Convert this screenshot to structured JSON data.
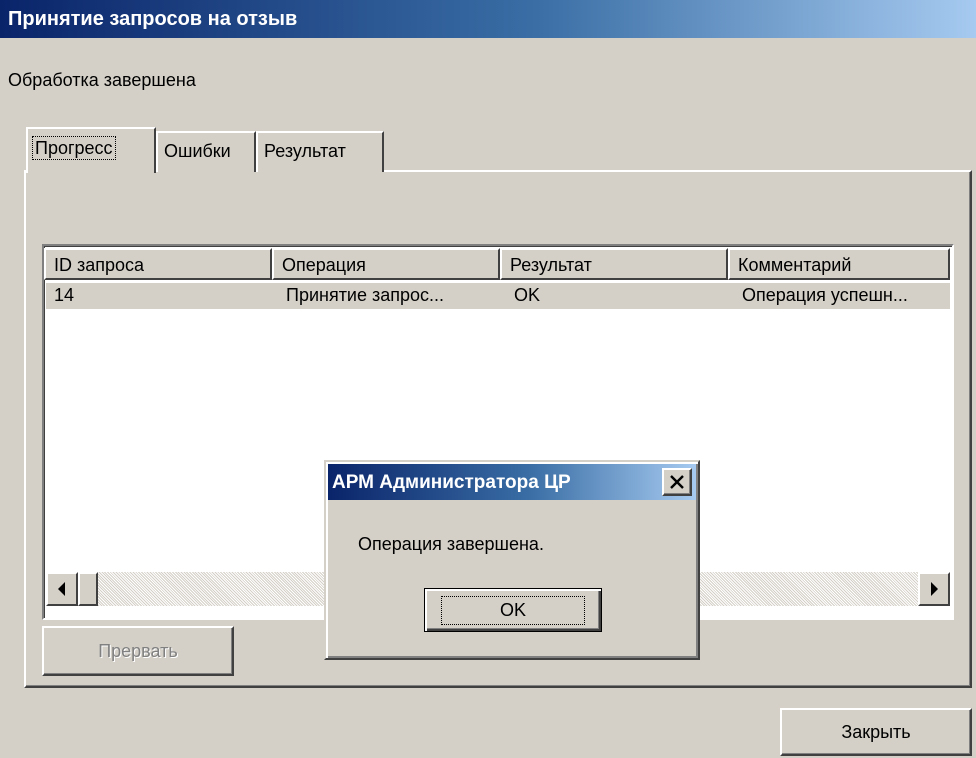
{
  "window": {
    "title": "Принятие запросов на отзыв"
  },
  "status": {
    "text": "Обработка завершена"
  },
  "tabs": [
    {
      "label": "Прогресс",
      "active": true
    },
    {
      "label": "Ошибки",
      "active": false
    },
    {
      "label": "Результат",
      "active": false
    }
  ],
  "table": {
    "columns": [
      "ID запроса",
      "Операция",
      "Результат",
      "Комментарий"
    ],
    "rows": [
      [
        "14",
        "Принятие запрос...",
        "OK",
        "Операция успешн..."
      ]
    ]
  },
  "buttons": {
    "abort_label": "Прервать",
    "close_label": "Закрыть"
  },
  "dialog": {
    "title": "АРМ Администратора ЦР",
    "message": "Операция завершена.",
    "ok_label": "OK",
    "close_glyph": "✕"
  },
  "colors": {
    "face": "#d4d0c8",
    "titlebar_start": "#0a246a",
    "titlebar_end": "#a6caf0"
  },
  "icons": {
    "scroll_left": "left-arrow-icon",
    "scroll_right": "right-arrow-icon",
    "dialog_close": "close-icon"
  }
}
